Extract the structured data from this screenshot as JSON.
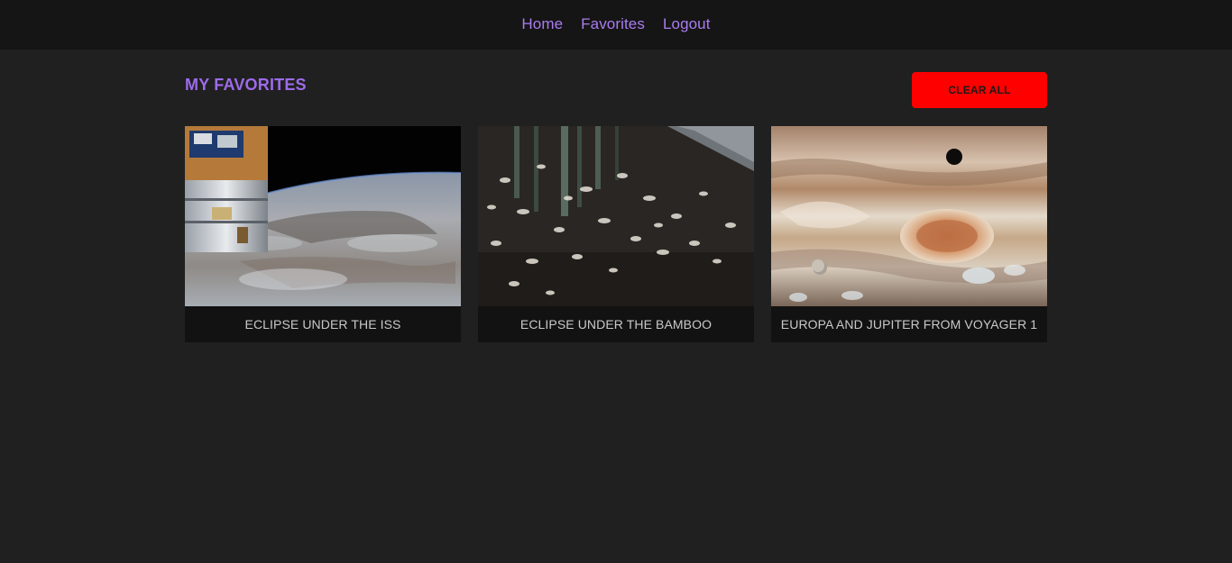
{
  "nav": {
    "items": [
      {
        "label": "Home"
      },
      {
        "label": "Favorites"
      },
      {
        "label": "Logout"
      }
    ]
  },
  "page": {
    "title": "MY FAVORITES",
    "clear_label": "CLEAR ALL"
  },
  "favorites": [
    {
      "title": "ECLIPSE UNDER THE ISS",
      "image": "earth-from-iss-photo"
    },
    {
      "title": "ECLIPSE UNDER THE BAMBOO",
      "image": "eclipse-shadows-bamboo-photo"
    },
    {
      "title": "EUROPA AND JUPITER FROM VOYAGER 1",
      "image": "jupiter-europa-photo"
    }
  ],
  "colors": {
    "background": "#202020",
    "navbar": "#151515",
    "accent": "#9d6bea",
    "danger": "#ff0000",
    "caption_bg": "#121212"
  }
}
